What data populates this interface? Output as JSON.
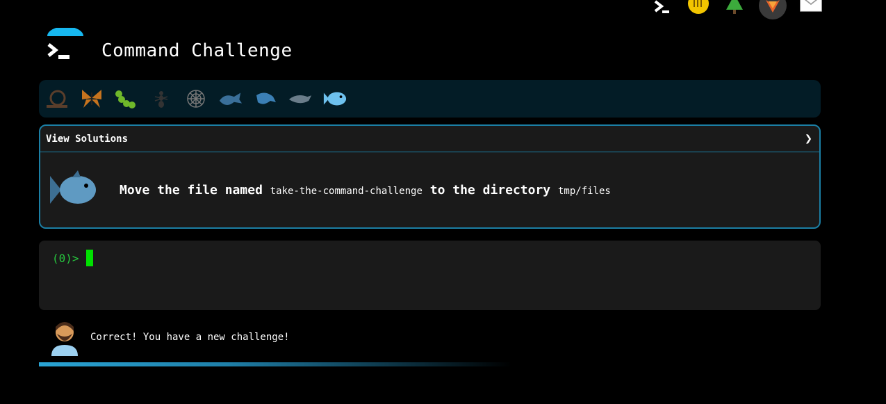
{
  "app": {
    "title": "Command Challenge"
  },
  "top_icons": [
    "terminal-icon",
    "hand-icon",
    "tree-icon",
    "fox-icon",
    "mail-icon"
  ],
  "levels": [
    "snail-icon",
    "butterfly-icon",
    "caterpillar-icon",
    "ant-icon",
    "spiderweb-icon",
    "whale-icon",
    "dolphin-icon",
    "dolphin-icon",
    "fish-icon"
  ],
  "challenge": {
    "solutions_label": "View Solutions",
    "chevron": "❯",
    "text_before": "Move the file named ",
    "file_name": "take-the-command-challenge",
    "text_middle": " to the directory ",
    "dir_name": "tmp/files"
  },
  "terminal": {
    "prompt": "(0)>"
  },
  "feedback": {
    "message": "Correct! You have a new challenge!"
  },
  "colors": {
    "accent": "#1b7fa5",
    "prompt": "#27c93f",
    "cursor": "#00e000",
    "level_bar": "#031c26"
  }
}
